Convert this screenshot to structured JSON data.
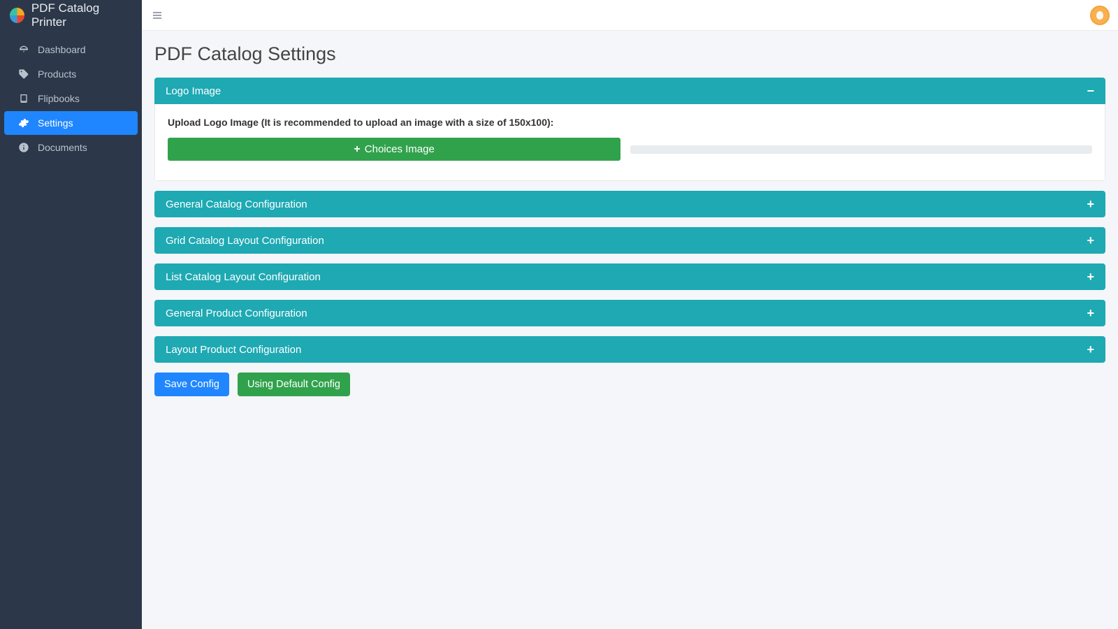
{
  "brand": {
    "name": "PDF Catalog Printer"
  },
  "sidebar": {
    "items": [
      {
        "label": "Dashboard",
        "icon": "dashboard"
      },
      {
        "label": "Products",
        "icon": "tag"
      },
      {
        "label": "Flipbooks",
        "icon": "book"
      },
      {
        "label": "Settings",
        "icon": "gear",
        "active": true
      },
      {
        "label": "Documents",
        "icon": "info"
      }
    ]
  },
  "page": {
    "title": "PDF Catalog Settings"
  },
  "panels": {
    "logo": {
      "title": "Logo Image",
      "expanded": true,
      "upload_label": "Upload Logo Image (It is recommended to upload an image with a size of 150x100):",
      "choose_button": "Choices Image"
    },
    "general_catalog": {
      "title": "General Catalog Configuration",
      "expanded": false
    },
    "grid_layout": {
      "title": "Grid Catalog Layout Configuration",
      "expanded": false
    },
    "list_layout": {
      "title": "List Catalog Layout Configuration",
      "expanded": false
    },
    "general_product": {
      "title": "General Product Configuration",
      "expanded": false
    },
    "layout_product": {
      "title": "Layout Product Configuration",
      "expanded": false
    }
  },
  "actions": {
    "save": "Save Config",
    "default": "Using Default Config"
  },
  "glyphs": {
    "minus": "−",
    "plus": "+"
  }
}
